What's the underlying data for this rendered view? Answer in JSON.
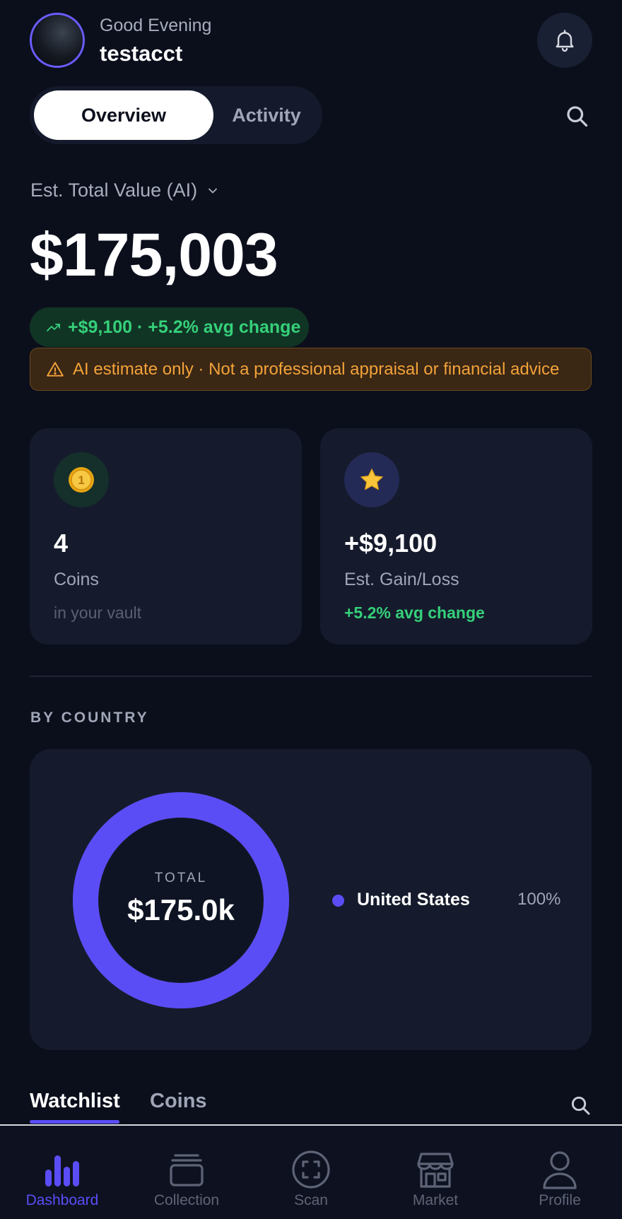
{
  "header": {
    "greeting": "Good Evening",
    "username": "testacct"
  },
  "tabs": {
    "overview": "Overview",
    "activity": "Activity"
  },
  "summary": {
    "est_label": "Est. Total Value (AI)",
    "total_value": "$175,003",
    "change_text": "+$9,100 · +5.2% avg change",
    "warning_text": "AI estimate only · Not a professional appraisal or financial advice"
  },
  "cards": {
    "coins": {
      "value": "4",
      "label": "Coins",
      "sub": "in your vault"
    },
    "gain": {
      "value": "+$9,100",
      "label": "Est. Gain/Loss",
      "sub": "+5.2% avg change"
    }
  },
  "by_country": {
    "title": "BY COUNTRY",
    "total_label": "TOTAL",
    "total_value": "$175.0k",
    "items": [
      {
        "name": "United States",
        "percent": "100%",
        "share": 1.0,
        "color": "#5b4df6"
      }
    ]
  },
  "watchlist": {
    "tab_watchlist": "Watchlist",
    "tab_coins": "Coins"
  },
  "nav": {
    "dashboard": "Dashboard",
    "collection": "Collection",
    "scan": "Scan",
    "market": "Market",
    "profile": "Profile"
  },
  "colors": {
    "background": "#0b0f1c",
    "card": "#151b2c",
    "accent": "#5b4df6",
    "positive": "#35d07a",
    "warning": "#f3a23a"
  }
}
